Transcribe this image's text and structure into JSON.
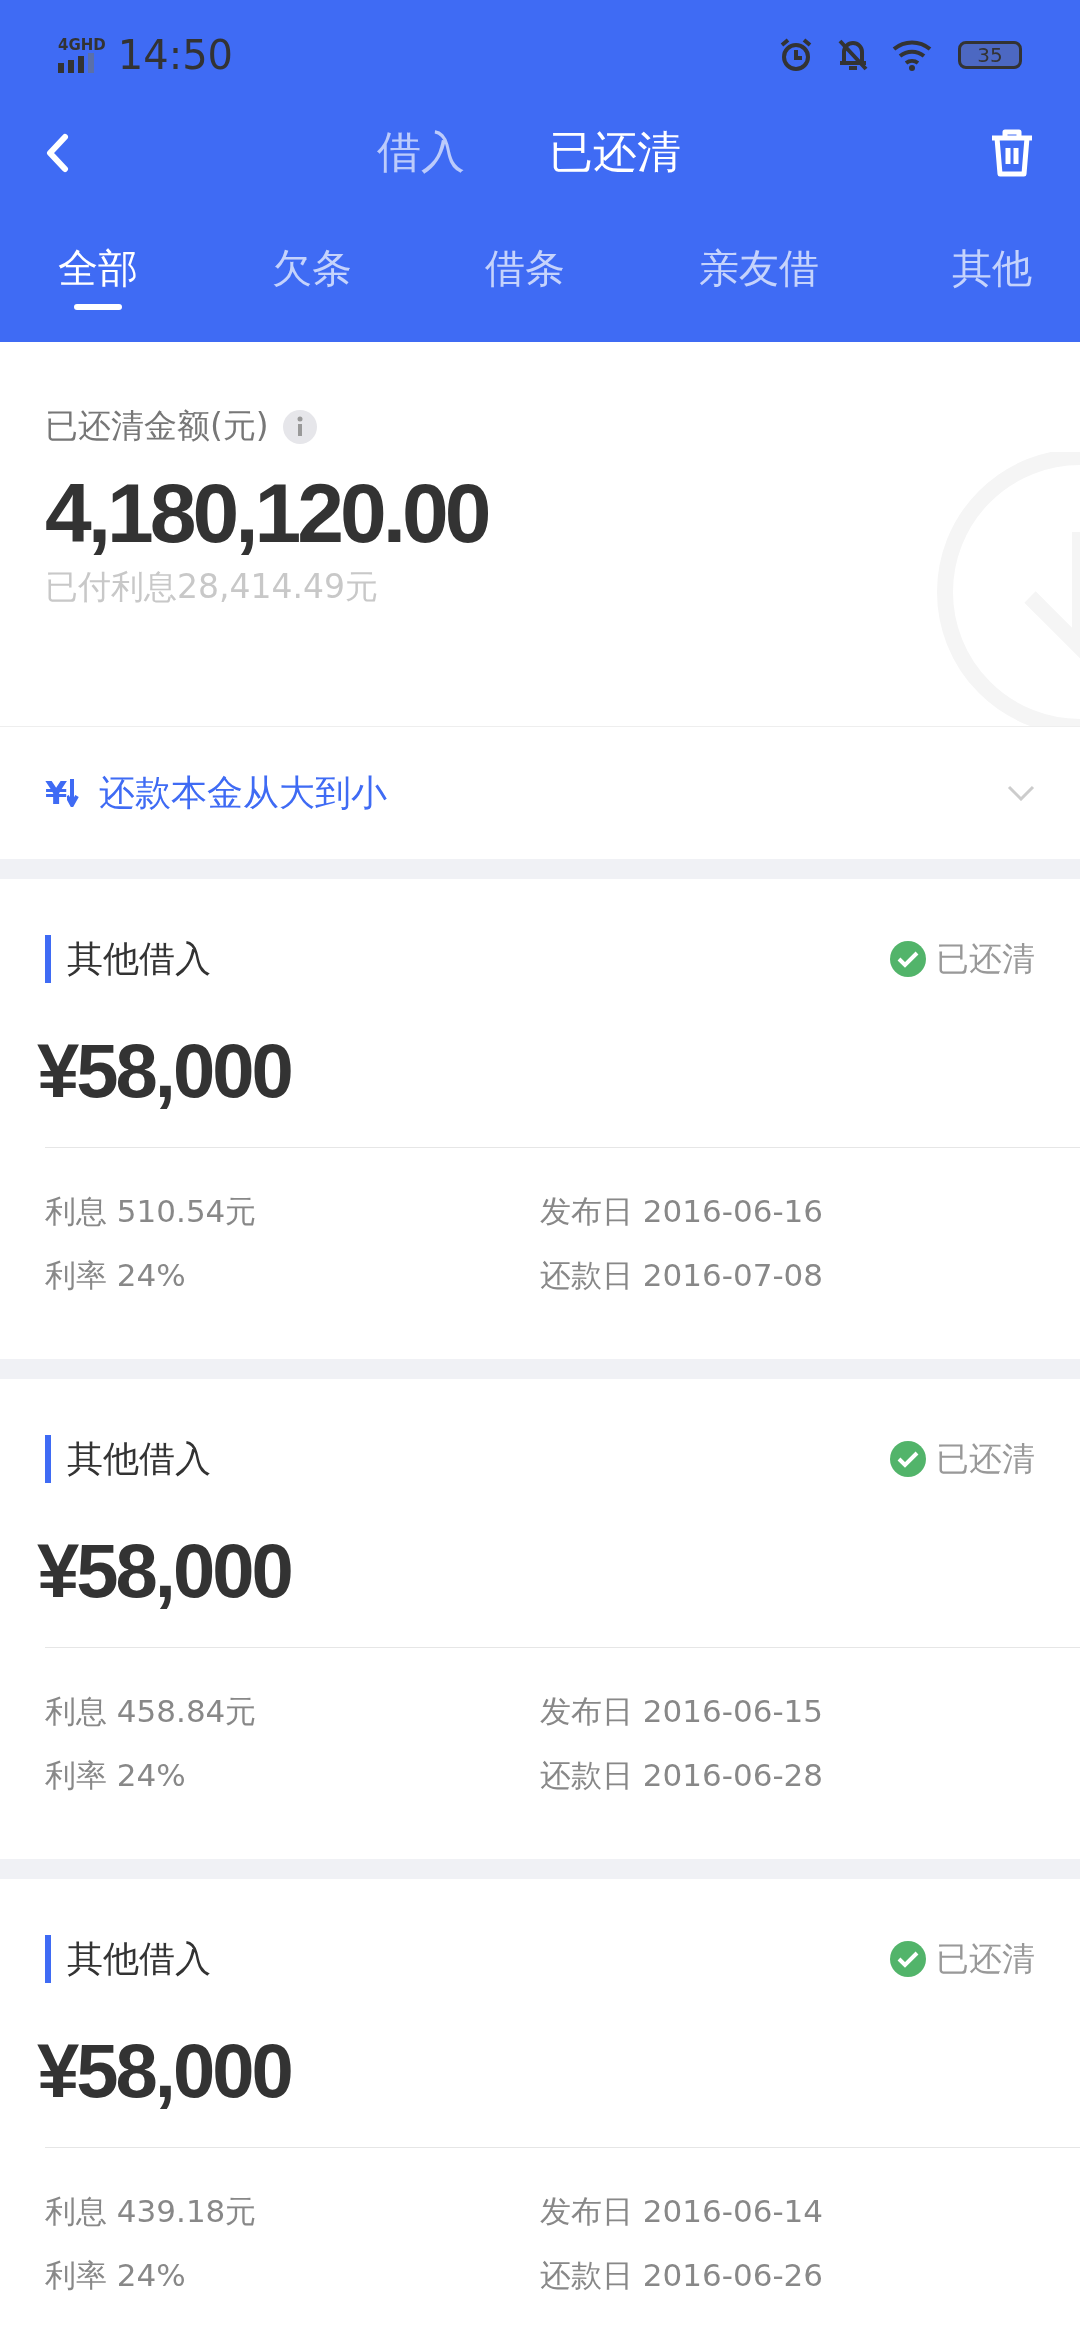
{
  "status_bar": {
    "network": "4GHD",
    "time": "14:50",
    "battery": "35"
  },
  "header": {
    "tabs": [
      {
        "label": "借入",
        "selected": false
      },
      {
        "label": "已还清",
        "selected": true
      }
    ]
  },
  "filter_tabs": [
    {
      "label": "全部",
      "selected": true
    },
    {
      "label": "欠条",
      "selected": false
    },
    {
      "label": "借条",
      "selected": false
    },
    {
      "label": "亲友借",
      "selected": false
    },
    {
      "label": "其他",
      "selected": false
    }
  ],
  "summary": {
    "label": "已还清金额(元)",
    "amount": "4,180,120.00",
    "interest": "已付利息28,414.49元"
  },
  "sort": {
    "icon": "¥",
    "label": "还款本金从大到小"
  },
  "loans": [
    {
      "title": "其他借入",
      "status": "已还清",
      "paid": true,
      "amount": "¥58,000",
      "interest": "利息 510.54元",
      "rate": "利率 24%",
      "issue": "发布日 2016-06-16",
      "repay": "还款日 2016-07-08"
    },
    {
      "title": "其他借入",
      "status": "已还清",
      "paid": true,
      "amount": "¥58,000",
      "interest": "利息 458.84元",
      "rate": "利率 24%",
      "issue": "发布日 2016-06-15",
      "repay": "还款日 2016-06-28"
    },
    {
      "title": "其他借入",
      "status": "已还清",
      "paid": true,
      "amount": "¥58,000",
      "interest": "利息 439.18元",
      "rate": "利率 24%",
      "issue": "发布日 2016-06-14",
      "repay": "还款日 2016-06-26"
    }
  ]
}
